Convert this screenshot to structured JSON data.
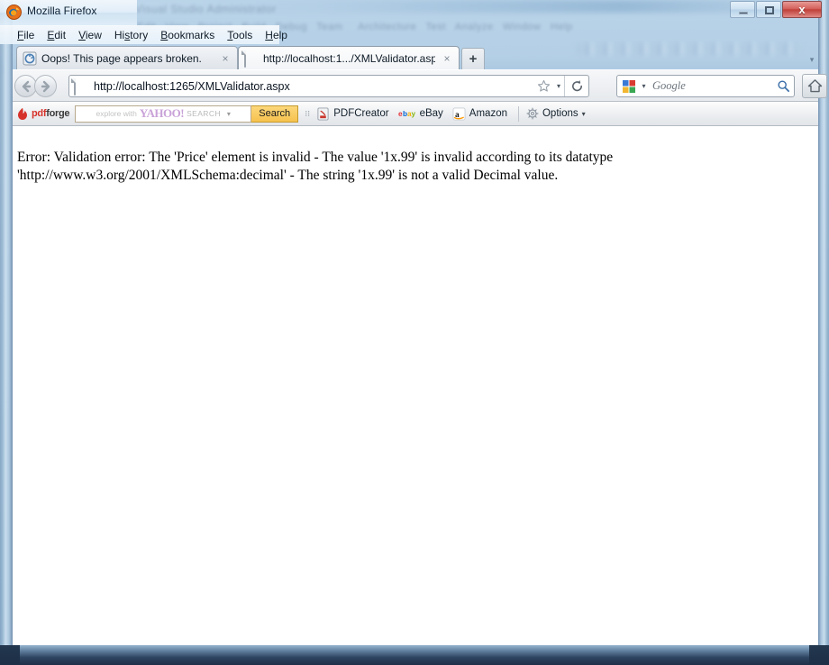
{
  "window": {
    "title": "Mozilla Firefox",
    "controls": {
      "minimize": "–",
      "maximize": "□",
      "close": "x"
    }
  },
  "menubar": {
    "items": [
      {
        "label": "File",
        "accel": "F"
      },
      {
        "label": "Edit",
        "accel": "E"
      },
      {
        "label": "View",
        "accel": "V"
      },
      {
        "label": "History",
        "accel": "s"
      },
      {
        "label": "Bookmarks",
        "accel": "B"
      },
      {
        "label": "Tools",
        "accel": "T"
      },
      {
        "label": "Help",
        "accel": "H"
      }
    ]
  },
  "tabs": {
    "items": [
      {
        "label": "Oops! This page appears broken.",
        "active": false,
        "close": "×"
      },
      {
        "label": "http://localhost:1.../XMLValidator.aspx",
        "active": true,
        "close": "×"
      }
    ],
    "new_tab_label": "+",
    "list_all_caret": "▾"
  },
  "navbar": {
    "back_label": "Back",
    "forward_label": "Forward",
    "url": "http://localhost:1265/XMLValidator.aspx",
    "star_caret": "▾",
    "reload_label": "Reload",
    "home_label": "Home",
    "search": {
      "engine": "Google",
      "placeholder": "Google",
      "caret": "▾"
    }
  },
  "addonbar": {
    "brand": {
      "pdf": "pdf",
      "forge": "forge"
    },
    "yahoo_search": {
      "explore": "explore with",
      "logo": "YAHOO!",
      "search_word": "SEARCH",
      "caret": "▾",
      "button_label": "Search"
    },
    "items": [
      {
        "label": "PDFCreator",
        "icon": "pdf-icon"
      },
      {
        "label": "eBay",
        "icon": "ebay-icon"
      },
      {
        "label": "Amazon",
        "icon": "amazon-icon"
      }
    ],
    "options": {
      "label": "Options",
      "caret": "▾"
    }
  },
  "content": {
    "error_message": "Error: Validation error: The 'Price' element is invalid - The value '1x.99' is invalid according to its datatype 'http://www.w3.org/2001/XMLSchema:decimal' - The string '1x.99' is not a valid Decimal value."
  },
  "background": {
    "blurred_app_title": "Visual Studio Administrator",
    "blurred_menus": [
      "Edit",
      "View",
      "Project",
      "Build",
      "Debug",
      "Team",
      "Architecture",
      "Test",
      "Analyze",
      "Window",
      "Help"
    ]
  },
  "colors": {
    "accent_orange": "#f6c24e",
    "brand_red": "#d6322a",
    "close_red": "#c0403a",
    "content_bg": "#ffffff",
    "glass_blue": "#9dc0dd"
  }
}
